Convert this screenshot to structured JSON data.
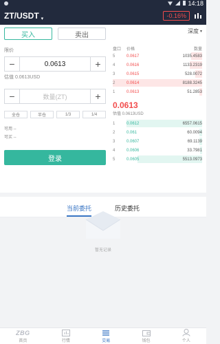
{
  "status": {
    "time": "14:18"
  },
  "header": {
    "pair": "ZT/USDT",
    "change": "-0.16%"
  },
  "trade": {
    "buy_tab": "买入",
    "sell_tab": "卖出",
    "price_label": "限价",
    "price_value": "0.0613",
    "price_est": "估值 0.0613USD",
    "amount_placeholder": "数量(ZT)",
    "pct_options": [
      "全仓",
      "半仓",
      "1/3",
      "1/4"
    ],
    "available": "可用 --",
    "buyable": "可买 --",
    "submit_label": "登录"
  },
  "orderbook": {
    "depth_label": "深度",
    "headers": {
      "level": "盘口",
      "price": "价格",
      "amount": "数量"
    },
    "asks": [
      {
        "level": "5",
        "price": "0.0617",
        "amount": "1035.4583",
        "fill": 0.12
      },
      {
        "level": "4",
        "price": "0.0616",
        "amount": "1133.2319",
        "fill": 0.14
      },
      {
        "level": "3",
        "price": "0.0615",
        "amount": "528.0072",
        "fill": 0.08
      },
      {
        "level": "2",
        "price": "0.0614",
        "amount": "8188.3245",
        "fill": 1.0
      },
      {
        "level": "1",
        "price": "0.0613",
        "amount": "51.2853",
        "fill": 0.03
      }
    ],
    "last_price": "0.0613",
    "last_est": "估值 0.0613USD",
    "bids": [
      {
        "level": "1",
        "price": "0.0612",
        "amount": "6557.0615",
        "fill": 0.85
      },
      {
        "level": "2",
        "price": "0.061",
        "amount": "60.0094",
        "fill": 0.03
      },
      {
        "level": "3",
        "price": "0.0607",
        "amount": "69.1139",
        "fill": 0.03
      },
      {
        "level": "4",
        "price": "0.0606",
        "amount": "33.7981",
        "fill": 0.02
      },
      {
        "level": "5",
        "price": "0.0605",
        "amount": "5513.0973",
        "fill": 0.72
      }
    ]
  },
  "orders": {
    "tab_current": "当前委托",
    "tab_history": "历史委托",
    "empty_text": "暂无记录"
  },
  "nav": {
    "logo": "ZBG",
    "items": [
      {
        "label": "首页"
      },
      {
        "label": "行情"
      },
      {
        "label": "交易"
      },
      {
        "label": "钱包"
      },
      {
        "label": "个人"
      }
    ]
  }
}
